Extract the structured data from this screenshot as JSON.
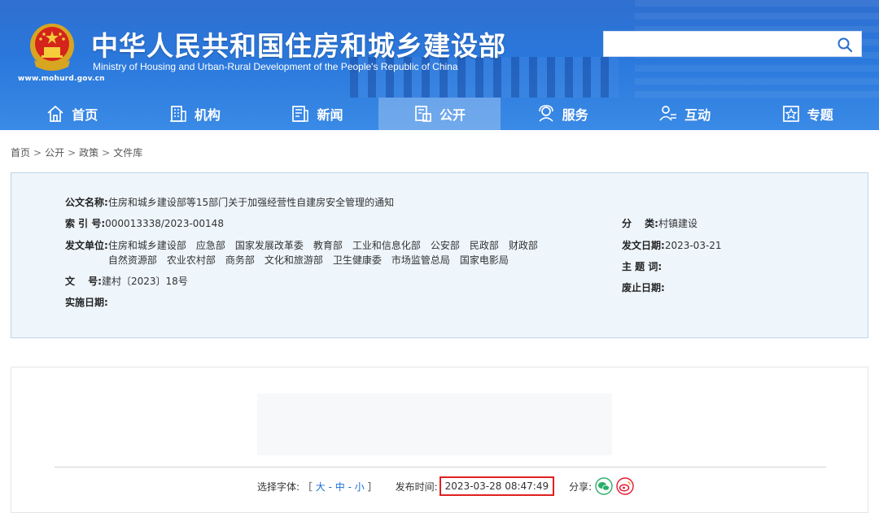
{
  "header": {
    "title": "中华人民共和国住房和城乡建设部",
    "subtitle": "Ministry of Housing and Urban-Rural Development of the People's Republic of China",
    "url": "www.mohurd.gov.cn",
    "search_placeholder": ""
  },
  "nav": [
    {
      "label": "首页",
      "icon": "home-icon"
    },
    {
      "label": "机构",
      "icon": "building-icon"
    },
    {
      "label": "新闻",
      "icon": "news-icon"
    },
    {
      "label": "公开",
      "icon": "open-icon",
      "active": true
    },
    {
      "label": "服务",
      "icon": "service-icon"
    },
    {
      "label": "互动",
      "icon": "interaction-icon"
    },
    {
      "label": "专题",
      "icon": "topic-icon"
    }
  ],
  "breadcrumb": [
    "首页",
    "公开",
    "政策",
    "文件库"
  ],
  "doc": {
    "name_label": "公文名称:",
    "name": "住房和城乡建设部等15部门关于加强经营性自建房安全管理的通知",
    "index_label": "索 引 号:",
    "index": "000013338/2023-00148",
    "issuer_label": "发文单位:",
    "issuers": [
      "住房和城乡建设部",
      "应急部",
      "国家发展改革委",
      "教育部",
      "工业和信息化部",
      "公安部",
      "民政部",
      "财政部",
      "自然资源部",
      "农业农村部",
      "商务部",
      "文化和旅游部",
      "卫生健康委",
      "市场监管总局",
      "国家电影局"
    ],
    "number_label": "文　 号:",
    "number": "建村〔2023〕18号",
    "effective_label": "实施日期:",
    "effective": "",
    "category_label": "分　 类:",
    "category": "村镇建设",
    "issue_date_label": "发文日期:",
    "issue_date": "2023-03-21",
    "keywords_label": "主 题 词:",
    "keywords": "",
    "expire_label": "废止日期:",
    "expire": ""
  },
  "meta": {
    "font_label": "选择字体:",
    "font_open": "［",
    "font_large": "大",
    "font_medium": "中",
    "font_small": "小",
    "font_sep": "-",
    "font_close": "］",
    "publish_label": "发布时间:",
    "publish_time": "2023-03-28 08:47:49",
    "share_label": "分享:",
    "share_icons": [
      "wechat-icon",
      "weibo-icon"
    ]
  },
  "colors": {
    "header_blue": "#2a78dc",
    "link_blue": "#1a6fd6",
    "highlight_red": "#e02020",
    "wechat_green": "#2aae67",
    "weibo_red": "#e6162d"
  }
}
